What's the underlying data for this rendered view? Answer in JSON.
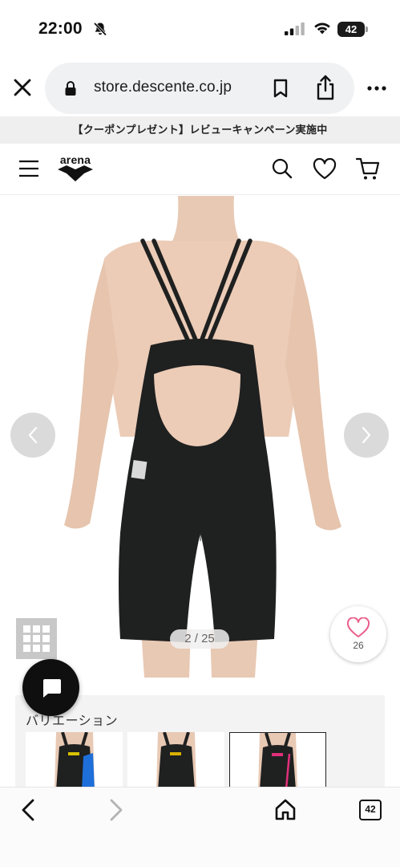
{
  "status_bar": {
    "time": "22:00",
    "battery_level": "42",
    "icons": [
      "bell-slash-icon",
      "cellular-signal-icon",
      "wifi-icon",
      "battery-icon"
    ]
  },
  "browser": {
    "url": "store.descente.co.jp",
    "tab_count": "42",
    "icons": [
      "close-icon",
      "lock-icon",
      "bookmark-icon",
      "share-icon",
      "more-icon",
      "back-icon",
      "forward-icon",
      "home-icon",
      "tabs-icon"
    ]
  },
  "promo_banner": {
    "text": "【クーポンプレゼント】レビューキャンペーン実施中"
  },
  "site_header": {
    "logo_text": "arena",
    "icons": [
      "hamburger-menu-icon",
      "search-icon",
      "heart-icon",
      "cart-icon"
    ]
  },
  "product_gallery": {
    "counter": "2 / 25",
    "like_count": "26",
    "icons": [
      "chevron-left-icon",
      "chevron-right-icon",
      "grid-icon",
      "heart-outline-icon"
    ]
  },
  "variation": {
    "title": "バリエーション",
    "thumbnails": [
      {
        "label": "black-blue",
        "accent": "#1e6fd9",
        "logo_color": "#d8c200",
        "selected": false
      },
      {
        "label": "black",
        "accent": "#1a1a1a",
        "logo_color": "#d8b000",
        "selected": false
      },
      {
        "label": "black-pink",
        "accent": "#e0307a",
        "logo_color": "#e0307a",
        "selected": true
      }
    ]
  },
  "colors": {
    "suit": "#1f2020",
    "skin": "#e8c9b4",
    "pink_heart": "#ea5f8b",
    "chat_bg": "#0f0f10"
  }
}
